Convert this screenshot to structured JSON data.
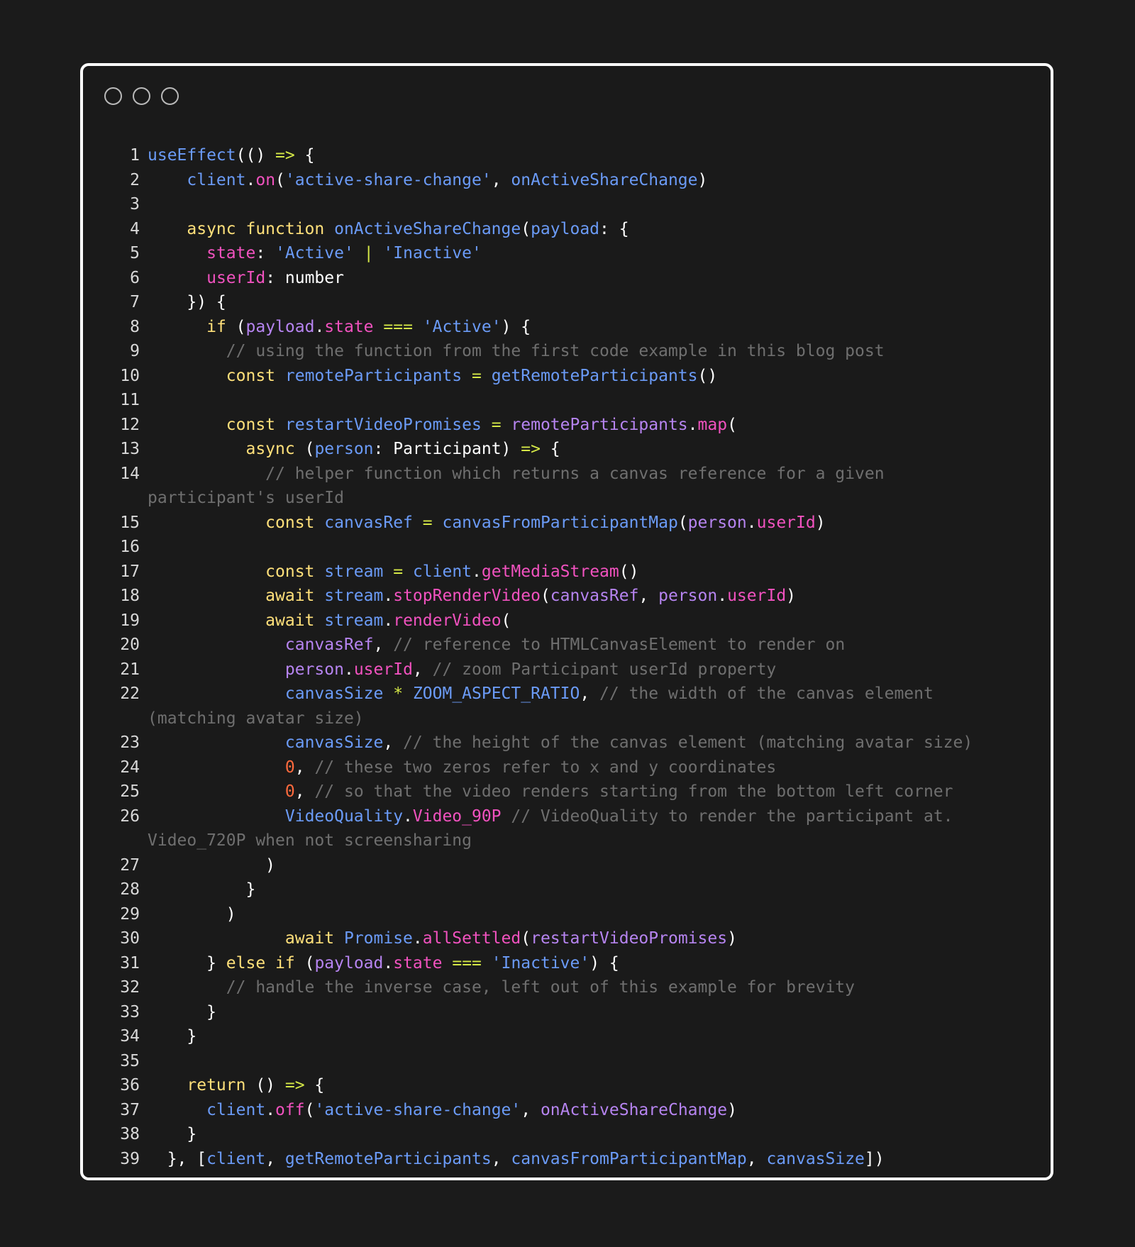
{
  "window": {
    "colors": {
      "background": "#1a1a1a",
      "border": "#ffffff",
      "keyword": "#ffe07a",
      "function": "#6b9bf7",
      "string": "#6b9bf7",
      "property": "#f152bf",
      "parameter": "#b684f0",
      "operator": "#d5e847",
      "comment": "#6f6f6f",
      "number": "#ff6a3d"
    }
  },
  "code": {
    "lines": [
      {
        "n": "1",
        "tokens": [
          [
            "fn",
            "useEffect"
          ],
          [
            "plain",
            "(() "
          ],
          [
            "op",
            "=>"
          ],
          [
            "plain",
            " {"
          ]
        ]
      },
      {
        "n": "2",
        "tokens": [
          [
            "plain",
            "    "
          ],
          [
            "fn",
            "client"
          ],
          [
            "plain",
            "."
          ],
          [
            "prop",
            "on"
          ],
          [
            "plain",
            "("
          ],
          [
            "str",
            "'active-share-change'"
          ],
          [
            "plain",
            ", "
          ],
          [
            "fn",
            "onActiveShareChange"
          ],
          [
            "plain",
            ")"
          ]
        ]
      },
      {
        "n": "3",
        "tokens": []
      },
      {
        "n": "4",
        "tokens": [
          [
            "plain",
            "    "
          ],
          [
            "kw",
            "async function "
          ],
          [
            "fn",
            "onActiveShareChange"
          ],
          [
            "plain",
            "("
          ],
          [
            "fn",
            "payload"
          ],
          [
            "plain",
            ": {"
          ]
        ]
      },
      {
        "n": "5",
        "tokens": [
          [
            "plain",
            "      "
          ],
          [
            "prop",
            "state"
          ],
          [
            "plain",
            ": "
          ],
          [
            "str",
            "'Active'"
          ],
          [
            "plain",
            " "
          ],
          [
            "op",
            "|"
          ],
          [
            "plain",
            " "
          ],
          [
            "str",
            "'Inactive'"
          ]
        ]
      },
      {
        "n": "6",
        "tokens": [
          [
            "plain",
            "      "
          ],
          [
            "prop",
            "userId"
          ],
          [
            "plain",
            ": number"
          ]
        ]
      },
      {
        "n": "7",
        "tokens": [
          [
            "plain",
            "    }) {"
          ]
        ]
      },
      {
        "n": "8",
        "tokens": [
          [
            "plain",
            "      "
          ],
          [
            "kw",
            "if"
          ],
          [
            "plain",
            " ("
          ],
          [
            "param",
            "payload"
          ],
          [
            "plain",
            "."
          ],
          [
            "prop",
            "state"
          ],
          [
            "plain",
            " "
          ],
          [
            "op",
            "==="
          ],
          [
            "plain",
            " "
          ],
          [
            "str",
            "'Active'"
          ],
          [
            "plain",
            ") {"
          ]
        ]
      },
      {
        "n": "9",
        "tokens": [
          [
            "plain",
            "        "
          ],
          [
            "cmt",
            "// using the function from the first code example in this blog post"
          ]
        ]
      },
      {
        "n": "10",
        "tokens": [
          [
            "plain",
            "        "
          ],
          [
            "kw",
            "const "
          ],
          [
            "fn",
            "remoteParticipants"
          ],
          [
            "plain",
            " "
          ],
          [
            "op",
            "="
          ],
          [
            "plain",
            " "
          ],
          [
            "fn",
            "getRemoteParticipants"
          ],
          [
            "plain",
            "()"
          ]
        ]
      },
      {
        "n": "11",
        "tokens": []
      },
      {
        "n": "12",
        "tokens": [
          [
            "plain",
            "        "
          ],
          [
            "kw",
            "const "
          ],
          [
            "fn",
            "restartVideoPromises"
          ],
          [
            "plain",
            " "
          ],
          [
            "op",
            "="
          ],
          [
            "plain",
            " "
          ],
          [
            "param",
            "remoteParticipants"
          ],
          [
            "plain",
            "."
          ],
          [
            "prop",
            "map"
          ],
          [
            "plain",
            "("
          ]
        ]
      },
      {
        "n": "13",
        "tokens": [
          [
            "plain",
            "          "
          ],
          [
            "kw",
            "async"
          ],
          [
            "plain",
            " ("
          ],
          [
            "fn",
            "person"
          ],
          [
            "plain",
            ": Participant) "
          ],
          [
            "op",
            "=>"
          ],
          [
            "plain",
            " {"
          ]
        ]
      },
      {
        "n": "14",
        "tokens": [
          [
            "plain",
            "            "
          ],
          [
            "cmt",
            "// helper function which returns a canvas reference for a given participant's userId"
          ]
        ]
      },
      {
        "n": "15",
        "tokens": [
          [
            "plain",
            "            "
          ],
          [
            "kw",
            "const "
          ],
          [
            "fn",
            "canvasRef"
          ],
          [
            "plain",
            " "
          ],
          [
            "op",
            "="
          ],
          [
            "plain",
            " "
          ],
          [
            "fn",
            "canvasFromParticipantMap"
          ],
          [
            "plain",
            "("
          ],
          [
            "param",
            "person"
          ],
          [
            "plain",
            "."
          ],
          [
            "prop",
            "userId"
          ],
          [
            "plain",
            ")"
          ]
        ]
      },
      {
        "n": "16",
        "tokens": []
      },
      {
        "n": "17",
        "tokens": [
          [
            "plain",
            "            "
          ],
          [
            "kw",
            "const "
          ],
          [
            "fn",
            "stream"
          ],
          [
            "plain",
            " "
          ],
          [
            "op",
            "="
          ],
          [
            "plain",
            " "
          ],
          [
            "fn",
            "client"
          ],
          [
            "plain",
            "."
          ],
          [
            "prop",
            "getMediaStream"
          ],
          [
            "plain",
            "()"
          ]
        ]
      },
      {
        "n": "18",
        "tokens": [
          [
            "plain",
            "            "
          ],
          [
            "kw",
            "await "
          ],
          [
            "fn",
            "stream"
          ],
          [
            "plain",
            "."
          ],
          [
            "prop",
            "stopRenderVideo"
          ],
          [
            "plain",
            "("
          ],
          [
            "param",
            "canvasRef"
          ],
          [
            "plain",
            ", "
          ],
          [
            "param",
            "person"
          ],
          [
            "plain",
            "."
          ],
          [
            "prop",
            "userId"
          ],
          [
            "plain",
            ")"
          ]
        ]
      },
      {
        "n": "19",
        "tokens": [
          [
            "plain",
            "            "
          ],
          [
            "kw",
            "await "
          ],
          [
            "fn",
            "stream"
          ],
          [
            "plain",
            "."
          ],
          [
            "prop",
            "renderVideo"
          ],
          [
            "plain",
            "("
          ]
        ]
      },
      {
        "n": "20",
        "tokens": [
          [
            "plain",
            "              "
          ],
          [
            "param",
            "canvasRef"
          ],
          [
            "plain",
            ", "
          ],
          [
            "cmt",
            "// reference to HTMLCanvasElement to render on"
          ]
        ]
      },
      {
        "n": "21",
        "tokens": [
          [
            "plain",
            "              "
          ],
          [
            "param",
            "person"
          ],
          [
            "plain",
            "."
          ],
          [
            "prop",
            "userId"
          ],
          [
            "plain",
            ", "
          ],
          [
            "cmt",
            "// zoom Participant userId property"
          ]
        ]
      },
      {
        "n": "22",
        "tokens": [
          [
            "plain",
            "              "
          ],
          [
            "fn",
            "canvasSize"
          ],
          [
            "plain",
            " "
          ],
          [
            "op",
            "*"
          ],
          [
            "plain",
            " "
          ],
          [
            "fn",
            "ZOOM_ASPECT_RATIO"
          ],
          [
            "plain",
            ", "
          ],
          [
            "cmt",
            "// the width of the canvas element (matching avatar size)"
          ]
        ]
      },
      {
        "n": "23",
        "tokens": [
          [
            "plain",
            "              "
          ],
          [
            "fn",
            "canvasSize"
          ],
          [
            "plain",
            ", "
          ],
          [
            "cmt",
            "// the height of the canvas element (matching avatar size)"
          ]
        ]
      },
      {
        "n": "24",
        "tokens": [
          [
            "plain",
            "              "
          ],
          [
            "num",
            "0"
          ],
          [
            "plain",
            ", "
          ],
          [
            "cmt",
            "// these two zeros refer to x and y coordinates"
          ]
        ]
      },
      {
        "n": "25",
        "tokens": [
          [
            "plain",
            "              "
          ],
          [
            "num",
            "0"
          ],
          [
            "plain",
            ", "
          ],
          [
            "cmt",
            "// so that the video renders starting from the bottom left corner"
          ]
        ]
      },
      {
        "n": "26",
        "tokens": [
          [
            "plain",
            "              "
          ],
          [
            "fn",
            "VideoQuality"
          ],
          [
            "plain",
            "."
          ],
          [
            "prop",
            "Video_90P"
          ],
          [
            "plain",
            " "
          ],
          [
            "cmt",
            "// VideoQuality to render the participant at. Video_720P when not screensharing"
          ]
        ]
      },
      {
        "n": "27",
        "tokens": [
          [
            "plain",
            "            )"
          ]
        ]
      },
      {
        "n": "28",
        "tokens": [
          [
            "plain",
            "          }"
          ]
        ]
      },
      {
        "n": "29",
        "tokens": [
          [
            "plain",
            "        )"
          ]
        ]
      },
      {
        "n": "30",
        "tokens": [
          [
            "plain",
            "              "
          ],
          [
            "kw",
            "await "
          ],
          [
            "fn",
            "Promise"
          ],
          [
            "plain",
            "."
          ],
          [
            "prop",
            "allSettled"
          ],
          [
            "plain",
            "("
          ],
          [
            "param",
            "restartVideoPromises"
          ],
          [
            "plain",
            ")"
          ]
        ]
      },
      {
        "n": "31",
        "tokens": [
          [
            "plain",
            "      } "
          ],
          [
            "kw",
            "else if"
          ],
          [
            "plain",
            " ("
          ],
          [
            "param",
            "payload"
          ],
          [
            "plain",
            "."
          ],
          [
            "prop",
            "state"
          ],
          [
            "plain",
            " "
          ],
          [
            "op",
            "==="
          ],
          [
            "plain",
            " "
          ],
          [
            "str",
            "'Inactive'"
          ],
          [
            "plain",
            ") {"
          ]
        ]
      },
      {
        "n": "32",
        "tokens": [
          [
            "plain",
            "        "
          ],
          [
            "cmt",
            "// handle the inverse case, left out of this example for brevity"
          ]
        ]
      },
      {
        "n": "33",
        "tokens": [
          [
            "plain",
            "      }"
          ]
        ]
      },
      {
        "n": "34",
        "tokens": [
          [
            "plain",
            "    }"
          ]
        ]
      },
      {
        "n": "35",
        "tokens": []
      },
      {
        "n": "36",
        "tokens": [
          [
            "plain",
            "    "
          ],
          [
            "kw",
            "return"
          ],
          [
            "plain",
            " () "
          ],
          [
            "op",
            "=>"
          ],
          [
            "plain",
            " {"
          ]
        ]
      },
      {
        "n": "37",
        "tokens": [
          [
            "plain",
            "      "
          ],
          [
            "fn",
            "client"
          ],
          [
            "plain",
            "."
          ],
          [
            "prop",
            "off"
          ],
          [
            "plain",
            "("
          ],
          [
            "str",
            "'active-share-change'"
          ],
          [
            "plain",
            ", "
          ],
          [
            "param",
            "onActiveShareChange"
          ],
          [
            "plain",
            ")"
          ]
        ]
      },
      {
        "n": "38",
        "tokens": [
          [
            "plain",
            "    }"
          ]
        ]
      },
      {
        "n": "39",
        "tokens": [
          [
            "plain",
            "  }, ["
          ],
          [
            "fn",
            "client"
          ],
          [
            "plain",
            ", "
          ],
          [
            "fn",
            "getRemoteParticipants"
          ],
          [
            "plain",
            ", "
          ],
          [
            "fn",
            "canvasFromParticipantMap"
          ],
          [
            "plain",
            ", "
          ],
          [
            "fn",
            "canvasSize"
          ],
          [
            "plain",
            "])"
          ]
        ]
      }
    ]
  }
}
